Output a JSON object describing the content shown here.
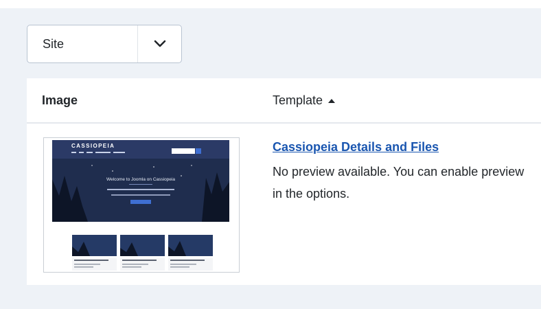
{
  "filter": {
    "selected": "Site"
  },
  "table": {
    "headers": {
      "image": "Image",
      "template": "Template"
    },
    "rows": [
      {
        "link_text": "Cassiopeia Details and Files",
        "description": "No preview available. You can enable preview in the options.",
        "thumbnail": {
          "brand": "CASSIOPEIA",
          "hero_title": "Welcome to Joomla on Cassiopeia"
        }
      }
    ]
  },
  "colors": {
    "link": "#1a56b0",
    "page_bg": "#eef2f7",
    "hero_bg": "#1f2d4e"
  }
}
